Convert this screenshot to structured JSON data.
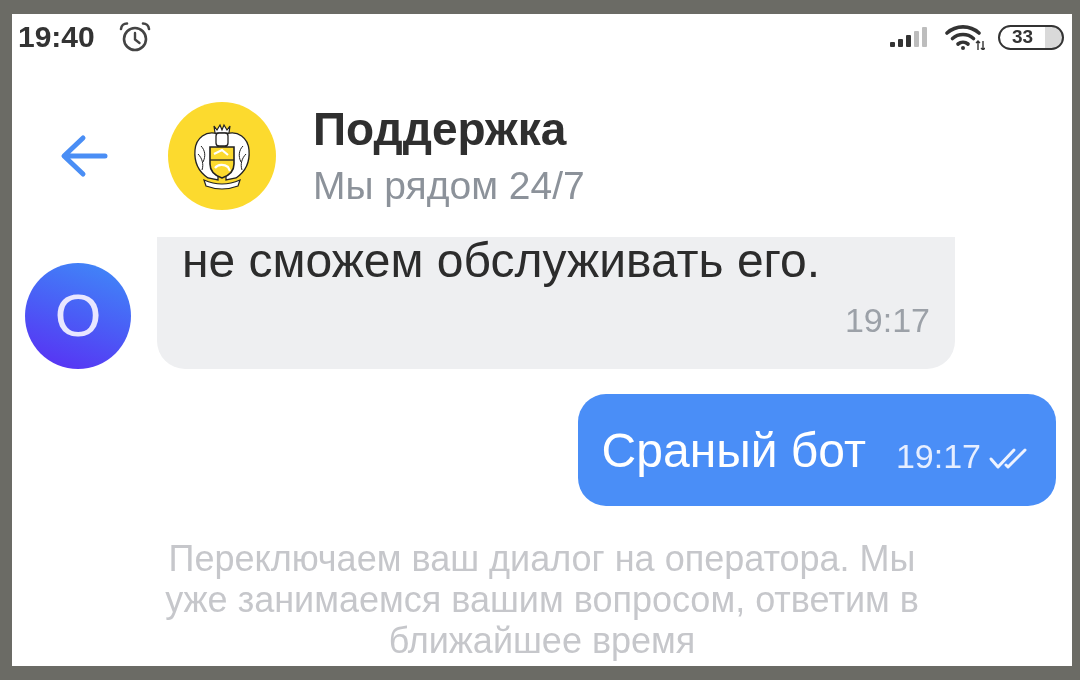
{
  "status_bar": {
    "time": "19:40",
    "battery": "33"
  },
  "header": {
    "title": "Поддержка",
    "subtitle": "Мы рядом 24/7"
  },
  "messages": [
    {
      "kind": "incoming",
      "avatar_letter": "О",
      "text": "не сможем обслуживать его.",
      "time": "19:17"
    },
    {
      "kind": "outgoing",
      "text": "Сраный бот",
      "time": "19:17",
      "read": true
    },
    {
      "kind": "system",
      "text": "Переключаем ваш диалог на оператора. Мы уже занимаемся вашим вопросом, ответим в ближайшее время"
    }
  ]
}
